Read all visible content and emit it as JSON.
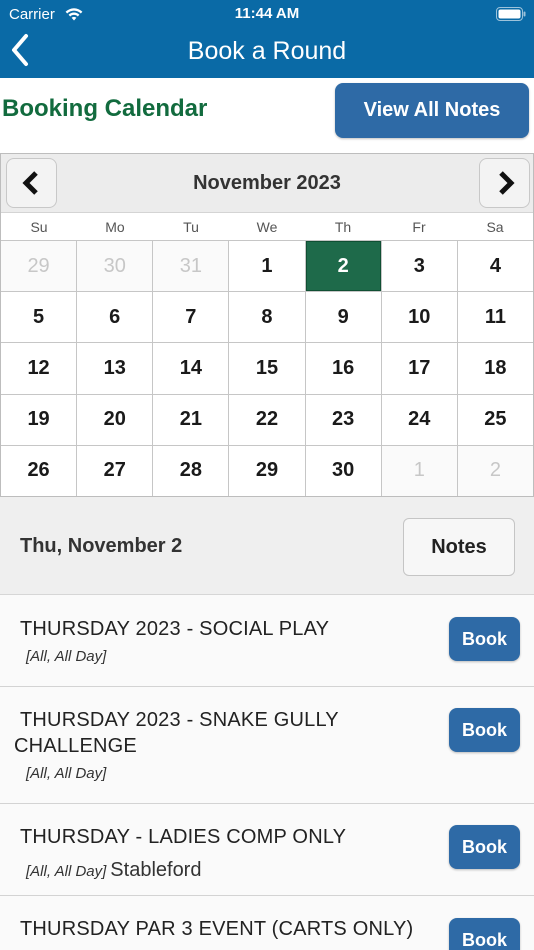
{
  "status_bar": {
    "carrier": "Carrier",
    "time": "11:44 AM"
  },
  "nav": {
    "title": "Book a Round"
  },
  "booking": {
    "heading": "Booking Calendar",
    "view_all_notes_label": "View All Notes"
  },
  "calendar": {
    "month_label": "November 2023",
    "weekdays": [
      "Su",
      "Mo",
      "Tu",
      "We",
      "Th",
      "Fr",
      "Sa"
    ],
    "days": [
      {
        "label": "29",
        "state": "muted"
      },
      {
        "label": "30",
        "state": "muted"
      },
      {
        "label": "31",
        "state": "muted"
      },
      {
        "label": "1",
        "state": ""
      },
      {
        "label": "2",
        "state": "selected"
      },
      {
        "label": "3",
        "state": ""
      },
      {
        "label": "4",
        "state": ""
      },
      {
        "label": "5",
        "state": ""
      },
      {
        "label": "6",
        "state": ""
      },
      {
        "label": "7",
        "state": ""
      },
      {
        "label": "8",
        "state": ""
      },
      {
        "label": "9",
        "state": ""
      },
      {
        "label": "10",
        "state": ""
      },
      {
        "label": "11",
        "state": ""
      },
      {
        "label": "12",
        "state": ""
      },
      {
        "label": "13",
        "state": ""
      },
      {
        "label": "14",
        "state": ""
      },
      {
        "label": "15",
        "state": ""
      },
      {
        "label": "16",
        "state": ""
      },
      {
        "label": "17",
        "state": ""
      },
      {
        "label": "18",
        "state": ""
      },
      {
        "label": "19",
        "state": ""
      },
      {
        "label": "20",
        "state": ""
      },
      {
        "label": "21",
        "state": ""
      },
      {
        "label": "22",
        "state": ""
      },
      {
        "label": "23",
        "state": ""
      },
      {
        "label": "24",
        "state": ""
      },
      {
        "label": "25",
        "state": ""
      },
      {
        "label": "26",
        "state": ""
      },
      {
        "label": "27",
        "state": ""
      },
      {
        "label": "28",
        "state": ""
      },
      {
        "label": "29",
        "state": ""
      },
      {
        "label": "30",
        "state": ""
      },
      {
        "label": "1",
        "state": "muted"
      },
      {
        "label": "2",
        "state": "muted"
      }
    ]
  },
  "selected_date": {
    "label": "Thu, November 2",
    "notes_label": "Notes"
  },
  "events": [
    {
      "title": "THURSDAY 2023 - SOCIAL PLAY",
      "meta": "[All, All Day]",
      "extra": "",
      "book_label": "Book"
    },
    {
      "title": "THURSDAY 2023 - SNAKE GULLY CHALLENGE",
      "meta": "[All, All Day]",
      "extra": "",
      "book_label": "Book"
    },
    {
      "title": "THURSDAY - LADIES COMP ONLY",
      "meta": "[All, All Day]",
      "extra": "Stableford",
      "book_label": "Book"
    },
    {
      "title": "THURSDAY PAR 3 EVENT (CARTS ONLY)",
      "meta": "",
      "extra": "",
      "book_label": "Book"
    }
  ],
  "colors": {
    "header": "#0a6aa6",
    "accent_button": "#2e6aa6",
    "heading_green": "#126b3e",
    "selected_day": "#1e6a4a"
  }
}
